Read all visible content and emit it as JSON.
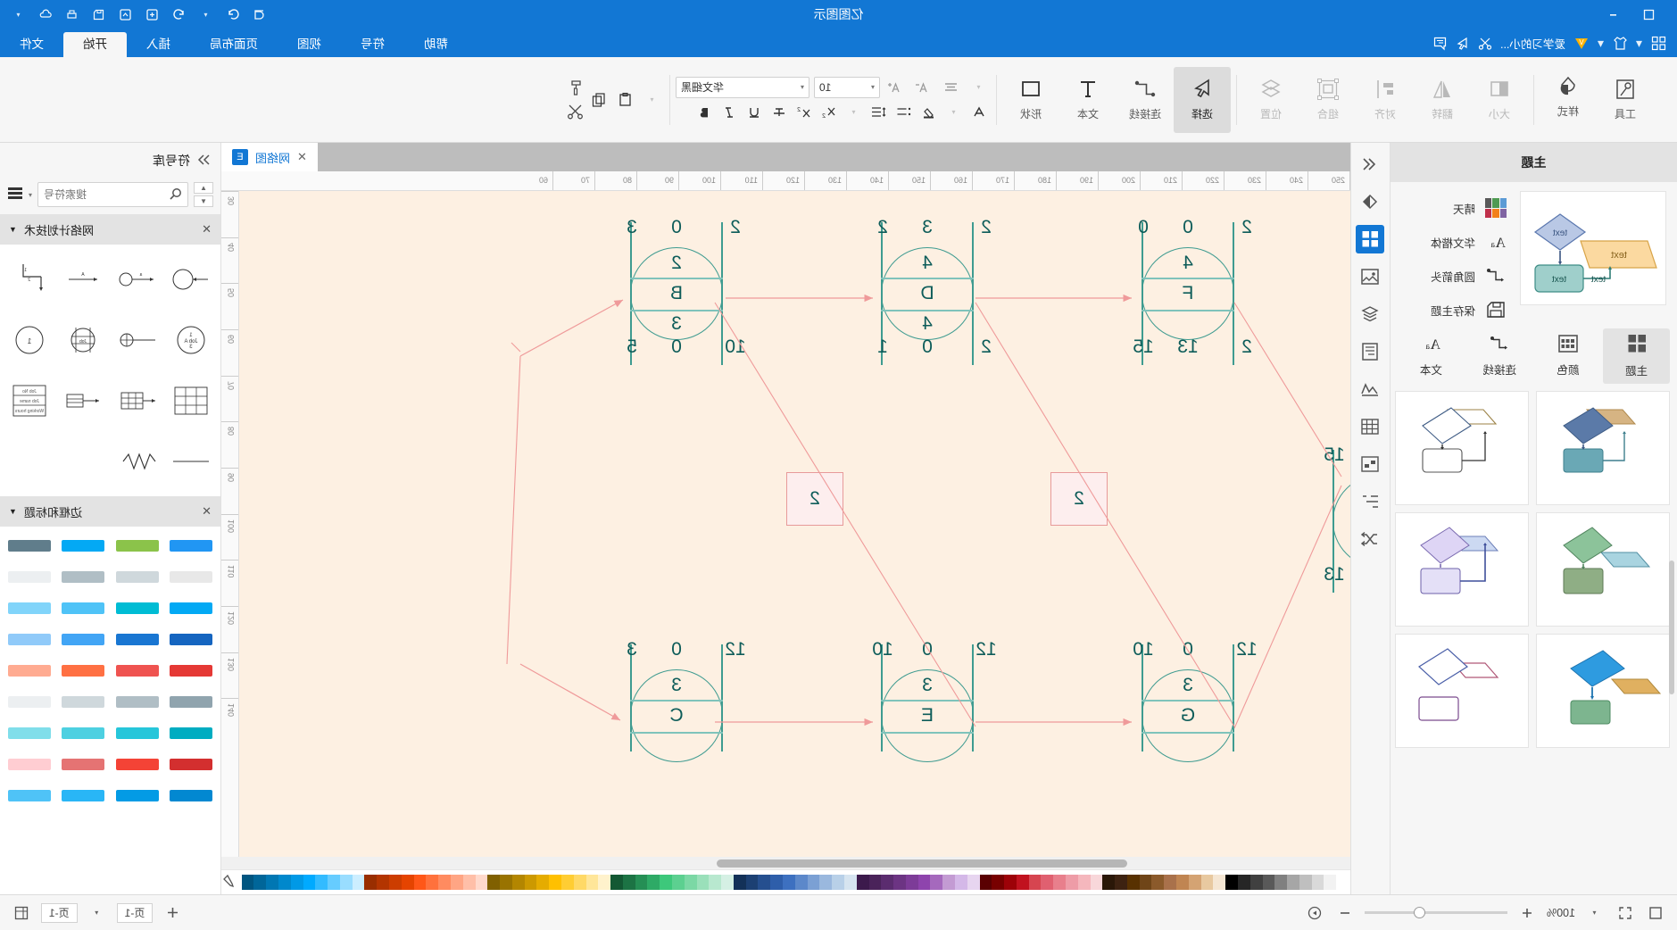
{
  "app": {
    "title": "亿图图示",
    "window_buttons": [
      "—",
      "▢",
      "✕"
    ]
  },
  "titlebar": {
    "left_icons": [
      "restore-icon",
      "minimize-icon"
    ],
    "right_icons": [
      "chevron-down-icon",
      "cloud-icon",
      "print-icon",
      "save-icon",
      "export-icon",
      "new-icon",
      "undo-icon",
      "redo-icon",
      "account-icon"
    ]
  },
  "quick_access": {
    "items": [
      "grid-icon",
      "caret",
      "shirt-icon",
      "caret",
      "vip-badge",
      "label",
      "cut-icon",
      "pointer-icon",
      "comment-icon"
    ],
    "label": "爱学习的小..."
  },
  "tabs": [
    {
      "label": "帮助",
      "active": false
    },
    {
      "label": "符号",
      "active": false
    },
    {
      "label": "视图",
      "active": false
    },
    {
      "label": "页面布局",
      "active": false
    },
    {
      "label": "插入",
      "active": false
    },
    {
      "label": "开始",
      "active": true
    },
    {
      "label": "文件",
      "active": false
    }
  ],
  "ribbon": {
    "groups_rtl": [
      {
        "label": "工具",
        "icon": "tools-icon",
        "state": "normal"
      },
      {
        "label": "样式",
        "icon": "paint-bucket-icon",
        "state": "normal"
      },
      {
        "label": "大小",
        "icon": "size-icon",
        "state": "disabled"
      },
      {
        "label": "翻转",
        "icon": "flip-icon",
        "state": "disabled"
      },
      {
        "label": "对齐",
        "icon": "align-icon",
        "state": "disabled"
      },
      {
        "label": "组合",
        "icon": "group-icon",
        "state": "disabled"
      },
      {
        "label": "位置",
        "icon": "layers-icon",
        "state": "disabled"
      },
      {
        "label": "选择",
        "icon": "cursor-icon",
        "state": "active"
      },
      {
        "label": "连接线",
        "icon": "connector-icon",
        "state": "normal"
      },
      {
        "label": "文本",
        "icon": "text-icon",
        "state": "normal"
      },
      {
        "label": "形状",
        "icon": "shape-icon",
        "state": "normal"
      }
    ],
    "font": {
      "name": "华文细黑",
      "size": "10"
    },
    "format_buttons": [
      "B",
      "I",
      "U",
      "S",
      "X₂",
      "X²",
      "line-spacing",
      "bullets",
      "align",
      "font-color",
      "A"
    ],
    "clipboard": [
      "paste-icon",
      "copy-icon",
      "format-painter-icon",
      "cut-icon"
    ]
  },
  "left_panel": {
    "header": "主题",
    "theme_rows": [
      {
        "label": "晴天",
        "icon": "color-swatch-icon"
      },
      {
        "label": "华文楷体",
        "icon": "font-Aa-icon"
      },
      {
        "label": "圆角箭头",
        "icon": "connector-icon"
      },
      {
        "label": "保存主题",
        "icon": "save-icon"
      }
    ],
    "tabs": [
      {
        "label": "文本",
        "icon": "font-Aa-icon",
        "active": false
      },
      {
        "label": "连接线",
        "icon": "connector-icon",
        "active": false
      },
      {
        "label": "颜色",
        "icon": "palette-grid-icon",
        "active": false
      },
      {
        "label": "主题",
        "icon": "theme-icon",
        "active": true
      }
    ],
    "preview_texts": [
      "text",
      "text",
      "text"
    ]
  },
  "vstrip": {
    "items": [
      "collapse-icon",
      "fill-icon",
      "theme-icon",
      "image-icon",
      "layers-icon",
      "page-icon",
      "chart-icon",
      "table-icon",
      "container-icon",
      "flow-icon",
      "shuffle-icon"
    ]
  },
  "doc_tab": {
    "label": "网络图",
    "icon": "edraw-doc-icon",
    "close": "✕"
  },
  "canvas": {
    "h_ruler_ticks": [
      "250",
      "240",
      "230",
      "220",
      "210",
      "200",
      "190",
      "180",
      "170",
      "160",
      "150",
      "140",
      "130",
      "120",
      "110",
      "100",
      "90",
      "80",
      "70",
      "60"
    ],
    "v_ruler_ticks": [
      "30",
      "40",
      "50",
      "60",
      "70",
      "80",
      "90",
      "100",
      "110",
      "120",
      "130",
      "140"
    ]
  },
  "diagram": {
    "type": "CPM / AOA network diagram",
    "top_nodes": [
      {
        "id": "F",
        "duration": "4",
        "top_left": "2",
        "top_mid": "0",
        "top_right": "0",
        "bottom_left": "2",
        "bottom_mid": "13",
        "bottom_right": "15"
      },
      {
        "id": "D",
        "duration": "4",
        "top_left": "2",
        "top_mid": "3",
        "top_right": "2",
        "bottom_left": "2",
        "bottom_mid": "0",
        "bottom_right": "1"
      },
      {
        "id": "B",
        "duration": "2",
        "sub": "3",
        "top_left": "2",
        "top_mid": "0",
        "top_right": "3",
        "bottom_left": "10",
        "bottom_mid": "0",
        "bottom_right": "5"
      }
    ],
    "bottom_nodes": [
      {
        "id": "G",
        "duration": "3",
        "top_left": "12",
        "top_mid": "0",
        "top_right": "10"
      },
      {
        "id": "E",
        "duration": "3",
        "top_left": "12",
        "top_mid": "0",
        "top_right": "10"
      },
      {
        "id": "C",
        "duration": "3",
        "top_left": "12",
        "top_mid": "0",
        "top_right": "3"
      }
    ],
    "square_nodes": [
      {
        "label": "2"
      },
      {
        "label": "2"
      }
    ],
    "left_markers": [
      "15",
      "13"
    ],
    "colors": {
      "node_stroke": "#3e9b90",
      "node_text": "#0d5c59",
      "connector": "#ef9a9a",
      "canvas_bg": "#fdf0e2",
      "square_fill": "#fdeeee"
    }
  },
  "right_panel": {
    "header": "符号库",
    "collapse_icon": "chevron-right-icon",
    "search_placeholder": "搜索符号",
    "library_sections": [
      {
        "title": "网络计划技术",
        "close": "✕"
      },
      {
        "title": "边框和标题",
        "close": "✕"
      }
    ]
  },
  "status_bar": {
    "zoom": "100%",
    "page_left": "页-1",
    "page_right": "页-1",
    "buttons": [
      "fullscreen-icon",
      "fit-icon",
      "minus-icon",
      "plus-icon",
      "presentation-icon",
      "add-page-icon",
      "page-dropdown-icon",
      "layout-icon"
    ]
  },
  "palette": {
    "colors": [
      "#ffffff",
      "#f2f2f2",
      "#d9d9d9",
      "#bfbfbf",
      "#a6a6a6",
      "#808080",
      "#595959",
      "#404040",
      "#262626",
      "#000000",
      "#f5e6d3",
      "#e8c9a0",
      "#d4a373",
      "#c08552",
      "#a9714b",
      "#8b5a2b",
      "#6f4518",
      "#583101",
      "#3d2211",
      "#2a1708",
      "#f8d7da",
      "#f5b7bd",
      "#ee9ca7",
      "#e87f8c",
      "#e06070",
      "#d64550",
      "#c1121f",
      "#9d0208",
      "#780000",
      "#5a0002",
      "#e7d5f0",
      "#d4b8e8",
      "#c39bd3",
      "#a569bd",
      "#8e44ad",
      "#7d3c98",
      "#6c3483",
      "#5b2c6f",
      "#4a235a",
      "#3c1a4c",
      "#d6e4f0",
      "#b8d0e8",
      "#9ab8de",
      "#7ba0d4",
      "#5c88ca",
      "#3d70c0",
      "#2e5eaa",
      "#254f8f",
      "#1c4073",
      "#133158",
      "#d5f0e4",
      "#b8e8cf",
      "#9ae0ba",
      "#7bd8a5",
      "#5cd090",
      "#3dc87b",
      "#2eaa66",
      "#258f55",
      "#1c7344",
      "#135833",
      "#fff2cc",
      "#ffe699",
      "#ffd966",
      "#ffcd33",
      "#ffc000",
      "#e5ac00",
      "#cc9900",
      "#b38600",
      "#997300",
      "#806000",
      "#ffd9cc",
      "#ffbfa8",
      "#ffa584",
      "#ff8b60",
      "#ff713c",
      "#ff5718",
      "#e54400",
      "#cc3d00",
      "#b33500",
      "#992e00",
      "#cceeff",
      "#99ddff",
      "#66ccff",
      "#33bbff",
      "#00aaff",
      "#0099e6",
      "#0088cc",
      "#0077b3",
      "#006699",
      "#005580"
    ]
  }
}
